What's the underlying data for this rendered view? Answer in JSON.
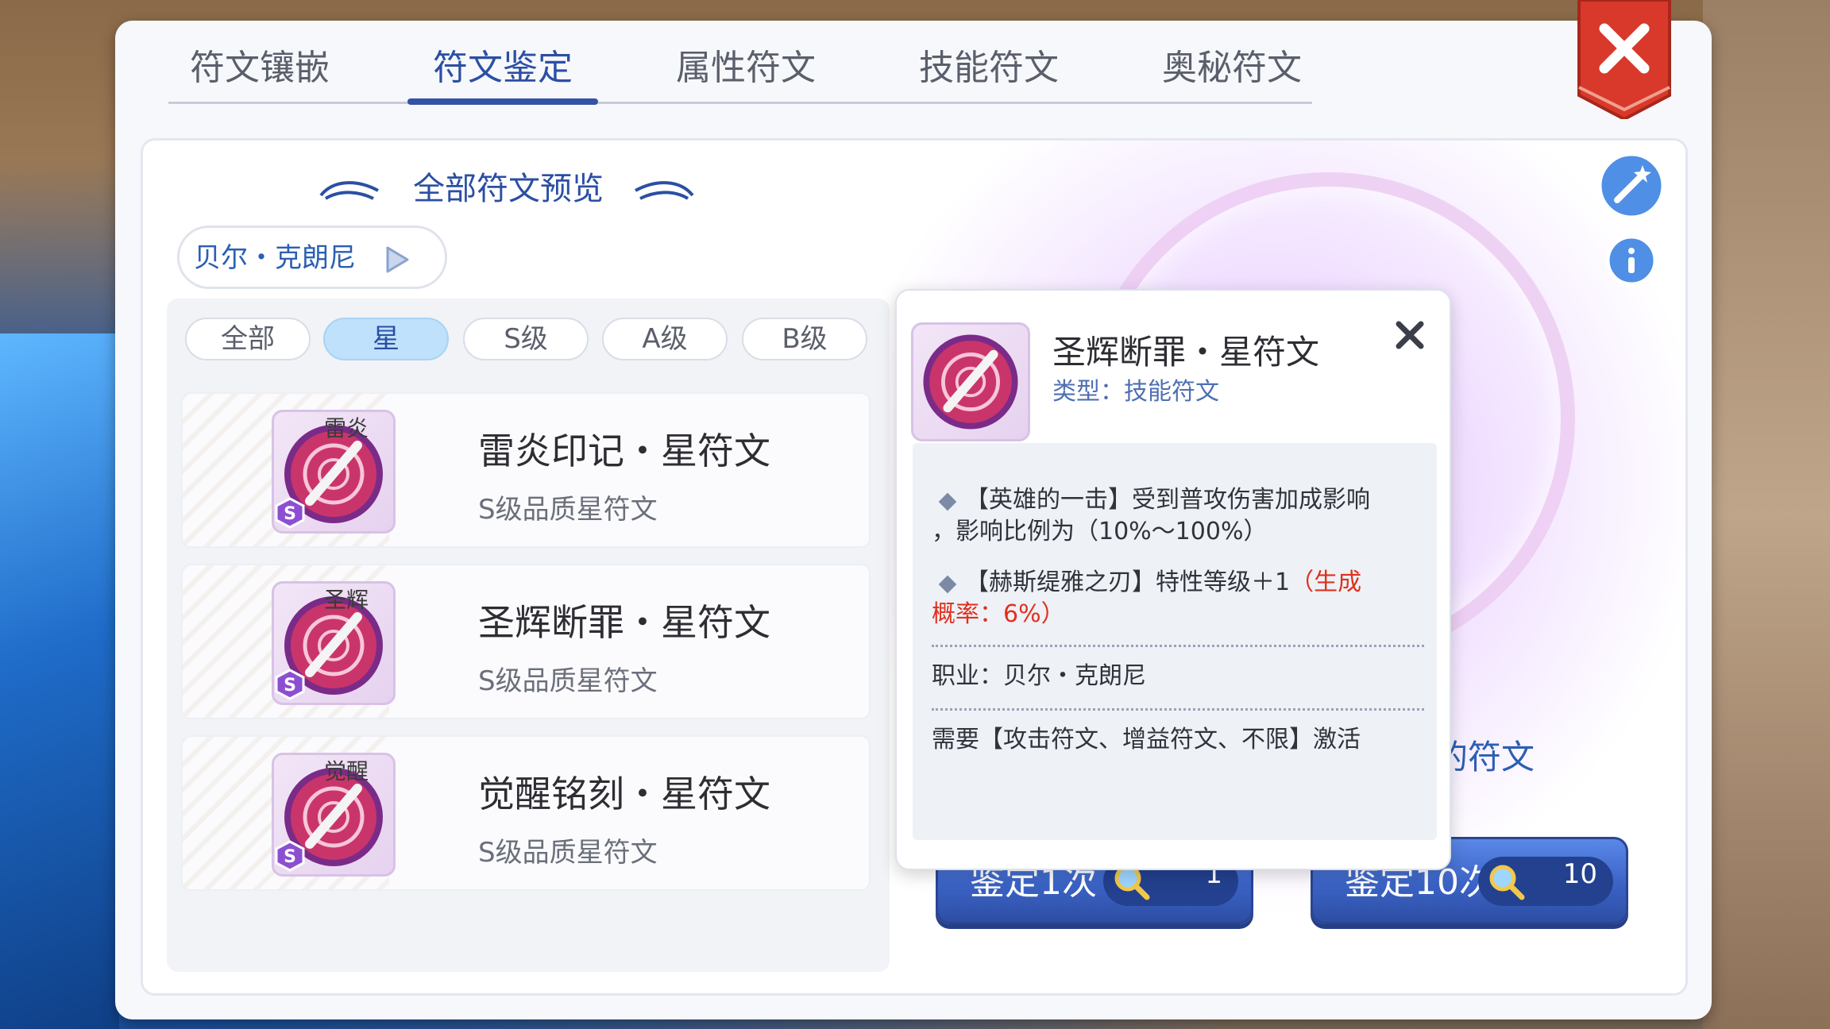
{
  "tabs": [
    {
      "label": "符文镶嵌"
    },
    {
      "label": "符文鉴定"
    },
    {
      "label": "属性符文"
    },
    {
      "label": "技能符文"
    },
    {
      "label": "奥秘符文"
    }
  ],
  "active_tab": "符文鉴定",
  "preview": {
    "title": "全部符文预览"
  },
  "character": {
    "name": "贝尔・克朗尼"
  },
  "filters": [
    {
      "label": "全部"
    },
    {
      "label": "星"
    },
    {
      "label": "S级"
    },
    {
      "label": "A级"
    },
    {
      "label": "B级"
    }
  ],
  "active_filter": "星",
  "rune_list": [
    {
      "tag": "雷炎",
      "name": "雷炎印记・星符文",
      "quality": "S级品质星符文",
      "badge": "S"
    },
    {
      "tag": "圣辉",
      "name": "圣辉断罪・星符文",
      "quality": "S级品质星符文",
      "badge": "S"
    },
    {
      "tag": "觉醒",
      "name": "觉醒铭刻・星符文",
      "quality": "S级品质星符文",
      "badge": "S"
    }
  ],
  "actions": {
    "single": {
      "label": "鉴定1次",
      "count": "1"
    },
    "ten": {
      "label": "鉴定10次",
      "count": "10"
    }
  },
  "behind_text": "的符文",
  "tooltip": {
    "title": "圣辉断罪・星符文",
    "type": "类型：技能符文",
    "effect1": "【英雄的一击】受到普攻伤害加成影响",
    "effect1_cont": "，影响比例为（10%～100%）",
    "effect2": "【赫斯缇雅之刃】特性等级＋1",
    "effect2_red_a": "（生成",
    "effect2_red_b": "概率：6%）",
    "job": "职业：贝尔・克朗尼",
    "requirement": "需要【攻击符文、增益符文、不限】激活"
  },
  "colors": {
    "accent": "#2b4fa3",
    "close_red": "#d8392b",
    "button_blue": "#3b63c6",
    "highlight_red": "#e0301e"
  },
  "icons": [
    "close-icon",
    "magic-wand-icon",
    "info-icon",
    "play-icon",
    "magnifier-icon",
    "rune-icon",
    "s-rank-badge-icon"
  ]
}
